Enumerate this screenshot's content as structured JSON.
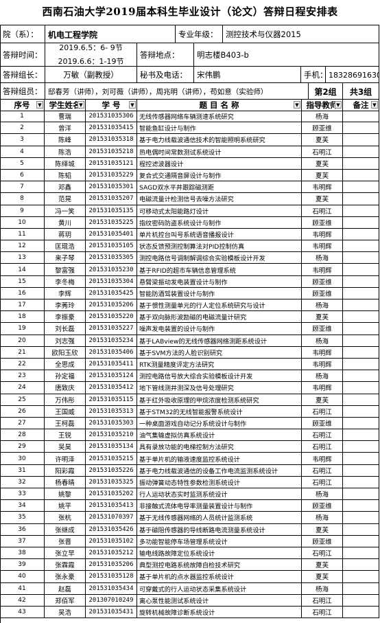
{
  "title": "西南石油大学2019届本科生毕业设计（论文）答辩日程安排表",
  "header": {
    "college_label": "院（系）：",
    "college": "机电工程学院",
    "major_label": "专业年级：",
    "major": "测控技术与仪器2015",
    "time_label": "答辩时间：",
    "time_line1": "2019.6.5：6- 9节",
    "time_line2": "2019.6.6：1-19节",
    "place_label": "答辩地点：",
    "place": "明志楼B403-b",
    "leader_label": "答辩组长：",
    "leader": "万敏（副教授）",
    "secretary_label": "秘书及电话：",
    "secretary": "宋伟鹏",
    "phone_label": "手机：",
    "phone": "18328691630",
    "members_label": "答辩组员：",
    "members": "邸春芳（讲师），刘可薇（讲师），周兆明（讲师），苟如意（实验师）",
    "group": "第2组",
    "group_total": "共3组"
  },
  "columns": {
    "num": "序号",
    "student": "学生姓名",
    "sid": "学  号",
    "topic": "题 目 名 称",
    "advisor": "指导教师",
    "note": "备注",
    "dropdown_icon": "▼"
  },
  "rows": [
    {
      "num": "1",
      "student": "曹瑞",
      "sid": "201531035306",
      "topic": "无线传感器网络车辆测速系统研究",
      "advisor": "杨海"
    },
    {
      "num": "2",
      "student": "曾洋",
      "sid": "201531035415",
      "topic": "智能鱼缸设计与制作",
      "advisor": "顾亚维"
    },
    {
      "num": "3",
      "student": "陈峰",
      "sid": "201531035318",
      "topic": "基于电力线载波通信技术的智能照明系统研究",
      "advisor": "夏芙"
    },
    {
      "num": "4",
      "student": "陈浩",
      "sid": "201531035218",
      "topic": "热电偶时间常数测试系统设计",
      "advisor": "石明江"
    },
    {
      "num": "5",
      "student": "陈绎城",
      "sid": "201531035121",
      "topic": "程控滤波器设计",
      "advisor": "夏芙"
    },
    {
      "num": "6",
      "student": "陈韬",
      "sid": "201531035229",
      "topic": "复合式交通隔音屏设计与制作",
      "advisor": "夏芙"
    },
    {
      "num": "7",
      "student": "邓鑫",
      "sid": "201531035301",
      "topic": "SAGD双水平井跟踪磁测距",
      "advisor": "韦明辉"
    },
    {
      "num": "8",
      "student": "范晃",
      "sid": "201531035207",
      "topic": "电磁流量计检测信号去噪方法研究",
      "advisor": "夏芙"
    },
    {
      "num": "9",
      "student": "冯一笑",
      "sid": "201531035135",
      "topic": "可移动式太阳能路灯设计",
      "advisor": "石明江"
    },
    {
      "num": "10",
      "student": "黄川",
      "sid": "201531035225",
      "topic": "指纹密码防盗系统设计与制作",
      "advisor": "顾亚维"
    },
    {
      "num": "11",
      "student": "蒋玥",
      "sid": "201531035401",
      "topic": "单片机控台叫号系统语音播报设计",
      "advisor": "韦明辉"
    },
    {
      "num": "12",
      "student": "匡琨浩",
      "sid": "201531035105",
      "topic": "状态反馈预测控制算法对PID控制仿真",
      "advisor": "韦明辉"
    },
    {
      "num": "13",
      "student": "来子琴",
      "sid": "201531035305",
      "topic": "测控电路信号调制解调综合实验模板设计开发",
      "advisor": "杨海"
    },
    {
      "num": "14",
      "student": "黎富强",
      "sid": "201531035230",
      "topic": "基于RFID的超市车辆信息管理系统",
      "advisor": "韦明辉"
    },
    {
      "num": "15",
      "student": "李冬梅",
      "sid": "201531035304",
      "topic": "悬臂梁振动发电装置设计与制作",
      "advisor": "顾亚维"
    },
    {
      "num": "16",
      "student": "李辉",
      "sid": "201531035425",
      "topic": "智能防酒驾装置设计与制作",
      "advisor": "顾亚维"
    },
    {
      "num": "17",
      "student": "李莠玲",
      "sid": "201531035206",
      "topic": "基于惯性测量单元的行人定位系统研究与设计",
      "advisor": "杨海"
    },
    {
      "num": "18",
      "student": "李振豪",
      "sid": "201531035220",
      "topic": "基于双向脉形波励磁的电磁流量计研究",
      "advisor": "夏芙"
    },
    {
      "num": "19",
      "student": "刘长磊",
      "sid": "201531035227",
      "topic": "噪声发电装置的设计与制作",
      "advisor": "顾亚维"
    },
    {
      "num": "20",
      "student": "刘志强",
      "sid": "201531035234",
      "topic": "基于LABview的无线传感器网络测距系统设计",
      "advisor": "杨海"
    },
    {
      "num": "21",
      "student": "欧阳玉欣",
      "sid": "201531035406",
      "topic": "基于SVM方法的人脸识别研究",
      "advisor": "韦明辉"
    },
    {
      "num": "22",
      "student": "全思成",
      "sid": "201531035411",
      "topic": "RTK测量精度评定方法研究",
      "advisor": "韦明辉"
    },
    {
      "num": "23",
      "student": "孙定福",
      "sid": "201531035124",
      "topic": "测控电路信号放大综合实验模板设计开发",
      "advisor": "杨海"
    },
    {
      "num": "24",
      "student": "唐致庆",
      "sid": "201531035412",
      "topic": "地下管线测井测深及信号处理研究",
      "advisor": "韦明辉"
    },
    {
      "num": "25",
      "student": "万伟彤",
      "sid": "201531035115",
      "topic": "基于红外吸收原理的甲烷浓度检测系统研究",
      "advisor": "夏芙"
    },
    {
      "num": "26",
      "student": "王国威",
      "sid": "201531035313",
      "topic": "基于STM32的无线智能报警系统设计",
      "advisor": "石明江"
    },
    {
      "num": "27",
      "student": "王柯磊",
      "sid": "201531035303",
      "topic": "一种桌面游戏自动记分系统设计与制作",
      "advisor": "顾亚维"
    },
    {
      "num": "28",
      "student": "王锐",
      "sid": "201531035210",
      "topic": "油气集输虚拟仿真系统设计",
      "advisor": "石明江"
    },
    {
      "num": "29",
      "student": "吴昊",
      "sid": "201531035134",
      "topic": "具有录放功能的电梯控制方法研究",
      "advisor": "石明江"
    },
    {
      "num": "30",
      "student": "许明泽",
      "sid": "201531035215",
      "topic": "基于单片机的输液速度监控系统设计",
      "advisor": "韦明辉"
    },
    {
      "num": "31",
      "student": "阳彩霞",
      "sid": "201531035226",
      "topic": "基于电力线载波通信的设备工作电流监测系统设计",
      "advisor": "石明江"
    },
    {
      "num": "32",
      "student": "杨春晴",
      "sid": "201531035325",
      "topic": "振动弹簧动态特性参数检测系统设计",
      "advisor": "石明江"
    },
    {
      "num": "33",
      "student": "姚黎",
      "sid": "201531035202",
      "topic": "行人运动状态实时监测系统设计",
      "advisor": "杨海"
    },
    {
      "num": "34",
      "student": "姚平",
      "sid": "201531035413",
      "topic": "非接触式流体电导率测量装置设计与制作",
      "advisor": "顾亚维"
    },
    {
      "num": "35",
      "student": "张杭",
      "sid": "201531070397",
      "topic": "基于无线传感器网络的人员统计监测系统",
      "advisor": "杨海"
    },
    {
      "num": "36",
      "student": "张继成",
      "sid": "201531035426",
      "topic": "基于磁阻传感器的导线断路电流测量系统设计",
      "advisor": "夏芙"
    },
    {
      "num": "37",
      "student": "张晋",
      "sid": "201531035102",
      "topic": "多功能智能停车场管理系统设计",
      "advisor": "顾亚维"
    },
    {
      "num": "38",
      "student": "张立早",
      "sid": "201531035212",
      "topic": "输电线路故障定位系统设计",
      "advisor": "石明江"
    },
    {
      "num": "39",
      "student": "张霖霞",
      "sid": "201531035206",
      "topic": "典型测控电路系统故障自检技术研究",
      "advisor": "夏芙"
    },
    {
      "num": "40",
      "student": "张永豪",
      "sid": "201531035128",
      "topic": "基于单片机的点水器监控系统设计",
      "advisor": "夏芙"
    },
    {
      "num": "41",
      "student": "赵磊",
      "sid": "201531035434",
      "topic": "可穿戴式的行人运动状态采集系统设计",
      "advisor": "杨海"
    },
    {
      "num": "42",
      "student": "郑佰军",
      "sid": "201307010249",
      "topic": "离心泵性能测试系统设计",
      "advisor": "石明江"
    },
    {
      "num": "43",
      "student": "吴浩",
      "sid": "201531035431",
      "topic": "旋转机械故障诊断系统设计",
      "advisor": "石明江"
    }
  ]
}
